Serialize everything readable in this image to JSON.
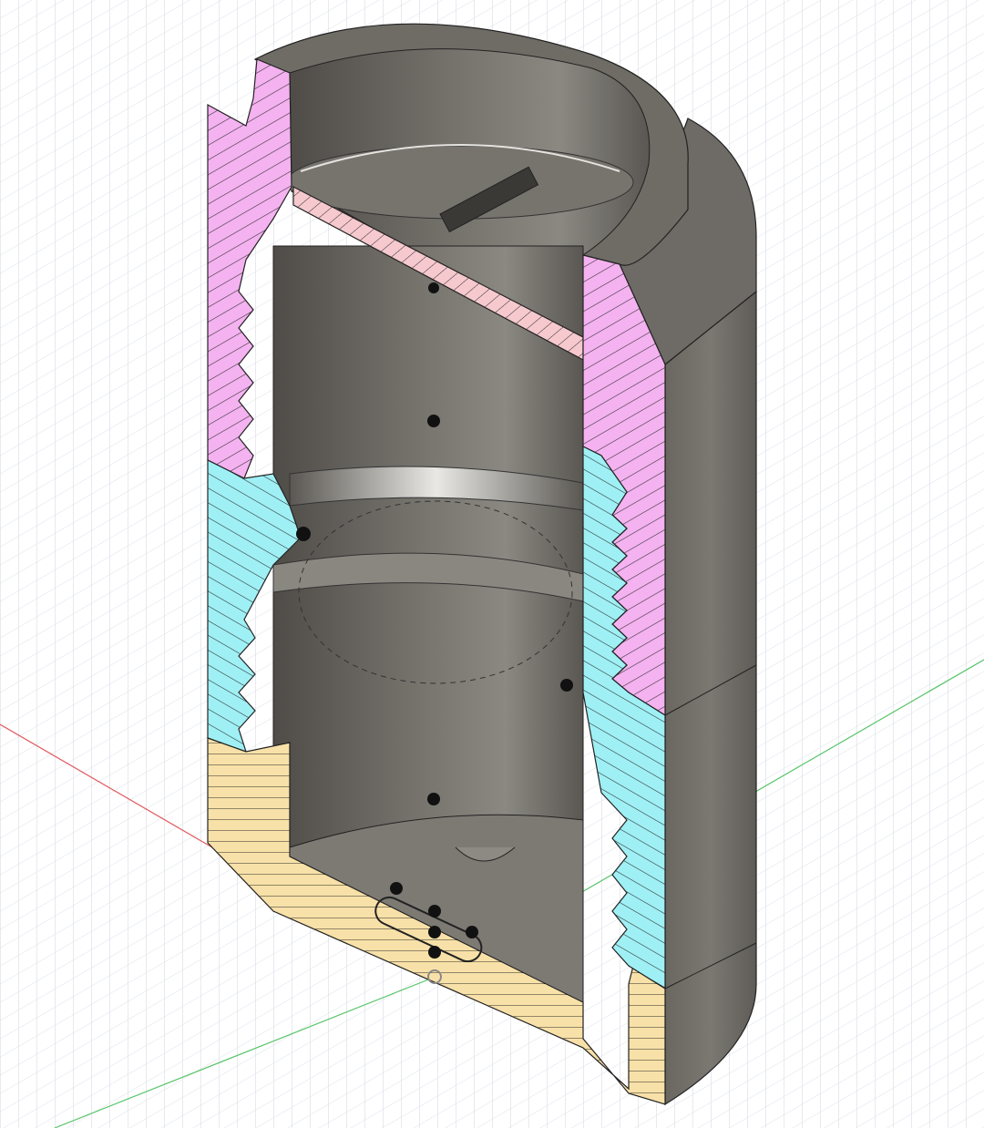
{
  "canvas": {
    "background": "#ffffff",
    "grid_color": "#d8dde4",
    "x_axis_color": "#e0585e",
    "y_axis_color": "#57c46a"
  },
  "model": {
    "body_color": "#6e6b66",
    "section_colors": {
      "top_cap": "#f4b2f0",
      "middle_sleeve": "#9ff0f5",
      "bottom_base": "#f8e1a8",
      "center_plate": "#f6c9ce"
    },
    "hatch_color": "#2a2a2a",
    "sketch_point_color": "#111111"
  }
}
